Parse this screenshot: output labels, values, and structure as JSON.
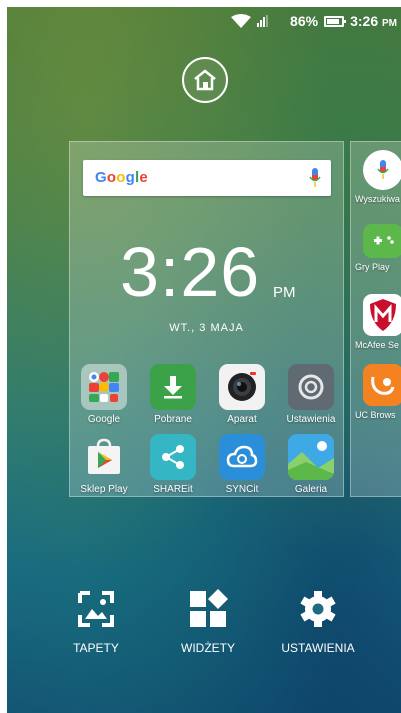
{
  "status_bar": {
    "battery": "86%",
    "time": "3:26",
    "ampm": "PM"
  },
  "search": {
    "logo": [
      "G",
      "o",
      "o",
      "g",
      "l",
      "e"
    ]
  },
  "clock": {
    "time": "3:26",
    "ampm": "PM",
    "date": "WT., 3 MAJA"
  },
  "apps": [
    {
      "label": "Google",
      "icon": "google-folder-icon"
    },
    {
      "label": "Pobrane",
      "icon": "download-icon"
    },
    {
      "label": "Aparat",
      "icon": "camera-icon"
    },
    {
      "label": "Ustawienia",
      "icon": "settings-gear-icon"
    },
    {
      "label": "Sklep Play",
      "icon": "play-store-icon"
    },
    {
      "label": "SHAREit",
      "icon": "share-icon"
    },
    {
      "label": "SYNCit",
      "icon": "cloud-sync-icon"
    },
    {
      "label": "Galeria",
      "icon": "gallery-icon"
    }
  ],
  "next_page_apps": [
    {
      "label": "Wyszukiwa",
      "icon": "voice-search-icon"
    },
    {
      "label": "Gry Play",
      "icon": "gamepad-icon"
    },
    {
      "label": "McAfee Se",
      "icon": "mcafee-icon"
    },
    {
      "label": "UC Brows",
      "icon": "uc-browser-icon"
    }
  ],
  "bottom_actions": [
    {
      "label": "TAPETY",
      "icon": "wallpaper-icon"
    },
    {
      "label": "WIDŻETY",
      "icon": "widgets-icon"
    },
    {
      "label": "USTAWIENIA",
      "icon": "gear-icon"
    }
  ],
  "colors": {
    "download": "#3ca24a",
    "camera": "#f2f2f2",
    "settings": "#606a72",
    "share": "#35b6c4",
    "sync": "#2a8fd8",
    "gallery": "#3fa9e6"
  }
}
